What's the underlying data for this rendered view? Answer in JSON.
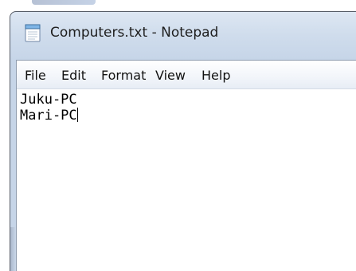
{
  "window": {
    "title": "Computers.txt - Notepad",
    "app_icon": "notepad-icon"
  },
  "menu": {
    "items": [
      {
        "label": "File"
      },
      {
        "label": "Edit"
      },
      {
        "label": "Format"
      },
      {
        "label": "View"
      },
      {
        "label": "Help"
      }
    ]
  },
  "editor": {
    "lines": [
      "Juku-PC",
      "Mari-PC"
    ]
  },
  "colors": {
    "title_bar": "#cfdcec",
    "menu_bar": "#f2f5fa",
    "text": "#000000"
  }
}
